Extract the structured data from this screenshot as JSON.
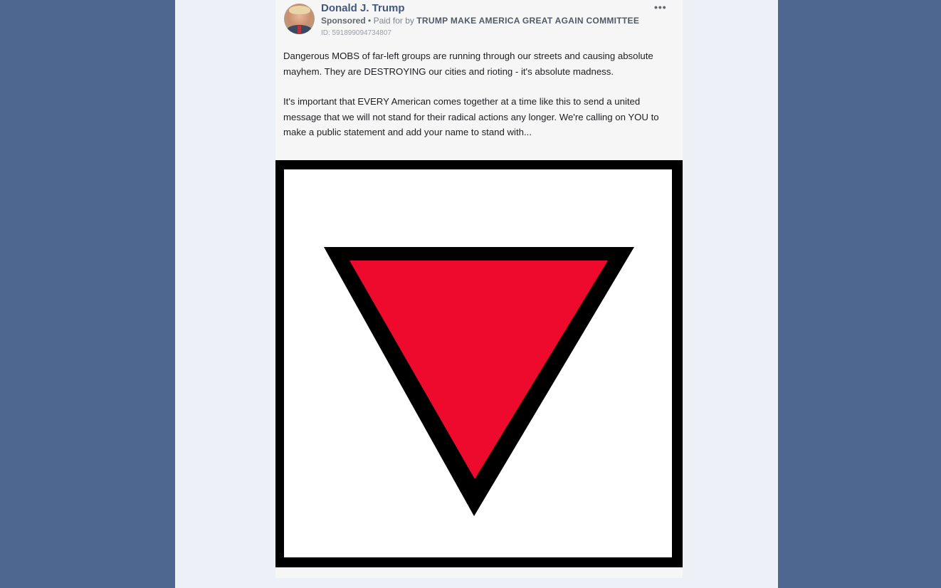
{
  "post": {
    "author_name": "Donald J. Trump",
    "sponsored_label": "Sponsored",
    "separator": "•",
    "paid_for_label": "Paid for by",
    "paid_for_org": "TRUMP MAKE AMERICA GREAT AGAIN COMMITTEE",
    "ad_id": "ID: 591899094734807",
    "more_options": "•••",
    "paragraph_1": "Dangerous MOBS of far-left groups are running through our streets and causing absolute mayhem. They are DESTROYING our cities and rioting - it's absolute madness.",
    "paragraph_2": "It's important that EVERY American comes together at a time like this to send a united message that we will not stand for their radical actions any longer. We're calling on YOU to make a public statement and add your name to stand with...",
    "image": {
      "symbol": "inverted-red-triangle",
      "fill_color": "#ee0a2c",
      "outline_color": "#000000",
      "frame_color": "#000000",
      "background_color": "#ffffff"
    }
  },
  "colors": {
    "side_background": "#4e6790",
    "center_background": "#edf1f7",
    "author_link": "#43577f"
  }
}
